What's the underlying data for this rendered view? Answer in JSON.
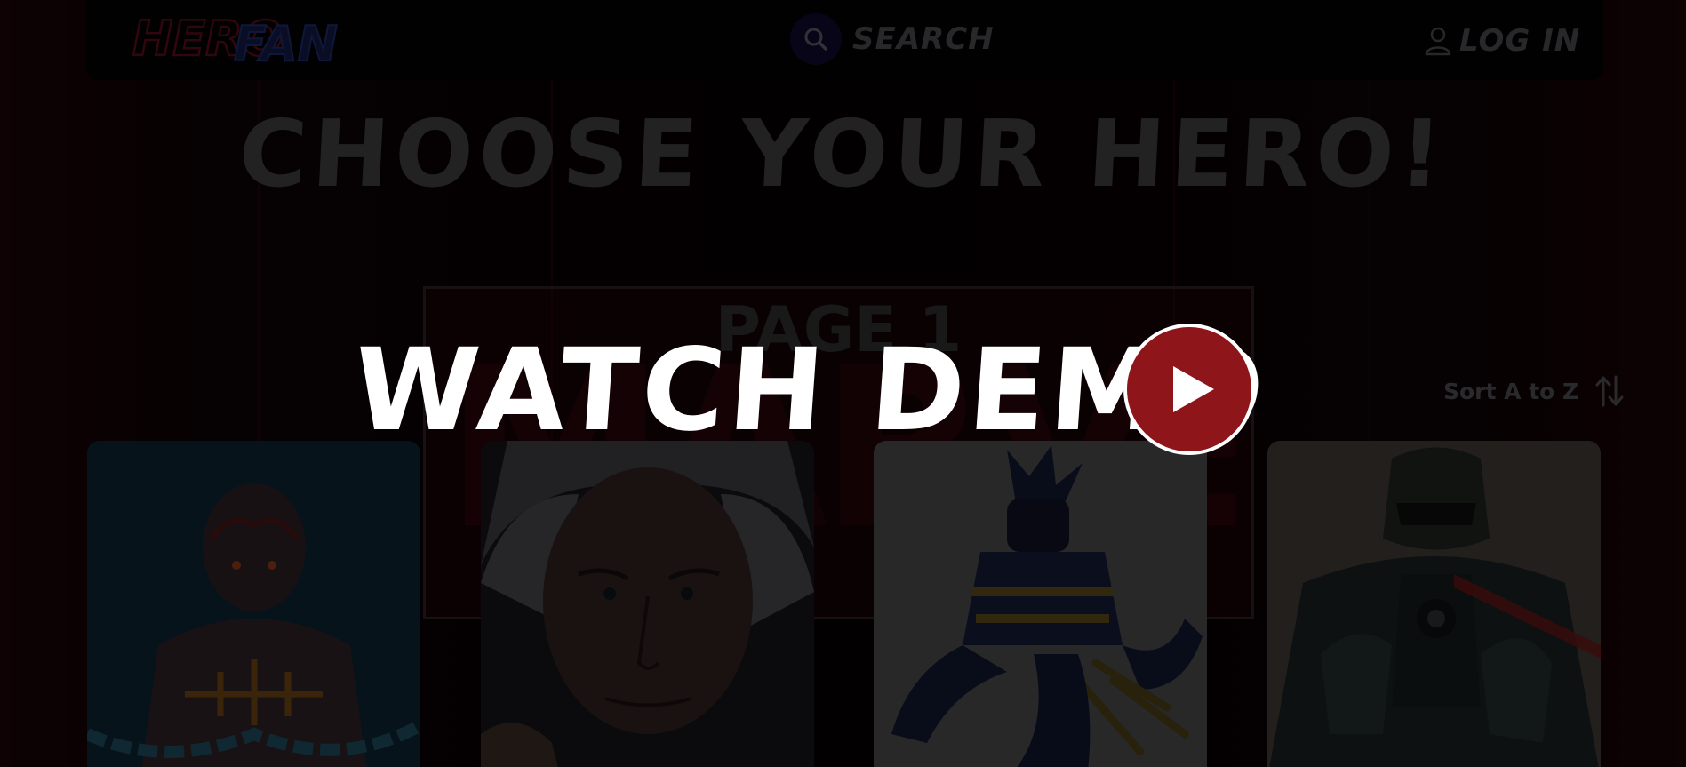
{
  "header": {
    "logo_text": "HERO FAN",
    "search_label": "SEARCH",
    "login_label": "LOG IN"
  },
  "main": {
    "title": "CHOOSE YOUR HERO!",
    "page_label": "PAGE 1",
    "background_logo_text": "MARVEL",
    "sort_label": "Sort A to Z"
  },
  "cards": [
    {
      "icon": "hero-portrait-chained-brute"
    },
    {
      "icon": "hero-portrait-old-man"
    },
    {
      "icon": "hero-portrait-clawed-warrior"
    },
    {
      "icon": "hero-portrait-armored-gunman"
    }
  ],
  "overlay": {
    "demo_label": "WATCH DEMO",
    "play_icon": "play-icon"
  },
  "colors": {
    "accent_red": "#8e1519",
    "search_circle": "#0d0a2a",
    "muted_text": "#4a4a4f"
  }
}
